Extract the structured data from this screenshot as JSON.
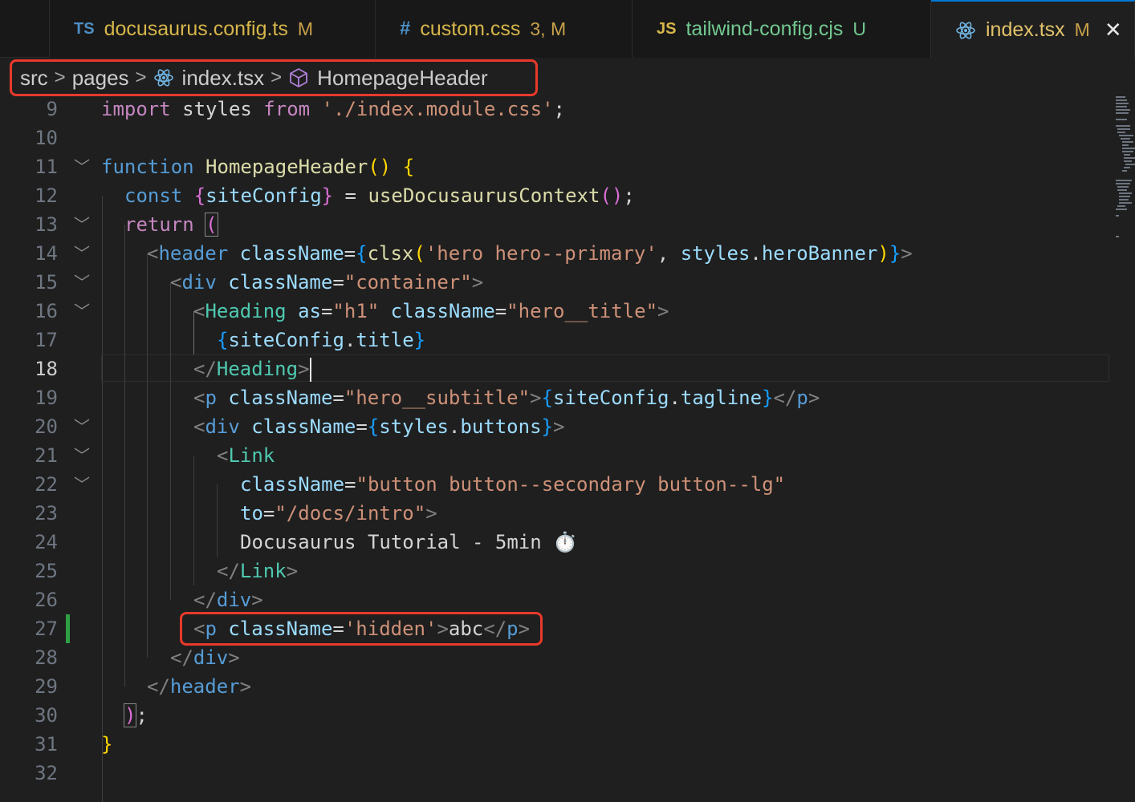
{
  "tabs": [
    {
      "icon": "TS",
      "name": "docusaurus.config.ts",
      "status": "M"
    },
    {
      "icon": "#",
      "name": "custom.css",
      "status": "3, M"
    },
    {
      "icon": "JS",
      "name": "tailwind-config.cjs",
      "status": "U"
    },
    {
      "icon": "react-icon",
      "name": "index.tsx",
      "status": "M"
    }
  ],
  "breadcrumb": {
    "items": [
      "src",
      "pages",
      "index.tsx",
      "HomepageHeader"
    ]
  },
  "editor": {
    "current_line": 18,
    "line_numbers": [
      "9",
      "10",
      "11",
      "12",
      "13",
      "14",
      "15",
      "16",
      "17",
      "18",
      "19",
      "20",
      "21",
      "22",
      "23",
      "24",
      "25",
      "26",
      "27",
      "28",
      "29",
      "30",
      "31",
      "32"
    ],
    "tokens": {
      "l9": [
        "import",
        " styles ",
        "from",
        " ",
        "'./index.module.css'",
        ";"
      ],
      "l11": [
        "function",
        " ",
        "HomepageHeader",
        "()",
        " ",
        "{"
      ],
      "l12": [
        "const",
        " ",
        "{",
        "siteConfig",
        "}",
        " = ",
        "useDocusaurusContext",
        "()",
        ";"
      ],
      "l13": [
        "return",
        " ",
        "("
      ],
      "l14": [
        "<",
        "header",
        " ",
        "className",
        "=",
        "{",
        "clsx",
        "(",
        "'hero hero--primary'",
        ", ",
        "styles",
        ".",
        "heroBanner",
        ")",
        "}",
        ">"
      ],
      "l15": [
        "<",
        "div",
        " ",
        "className",
        "=",
        "\"container\"",
        ">"
      ],
      "l16": [
        "<",
        "Heading",
        " ",
        "as",
        "=",
        "\"h1\"",
        " ",
        "className",
        "=",
        "\"hero__title\"",
        ">"
      ],
      "l17": [
        "{",
        "siteConfig",
        ".",
        "title",
        "}"
      ],
      "l18": [
        "</",
        "Heading",
        ">"
      ],
      "l19": [
        "<",
        "p",
        " ",
        "className",
        "=",
        "\"hero__subtitle\"",
        ">",
        "{",
        "siteConfig",
        ".",
        "tagline",
        "}",
        "</",
        "p",
        ">"
      ],
      "l20": [
        "<",
        "div",
        " ",
        "className",
        "=",
        "{",
        "styles",
        ".",
        "buttons",
        "}",
        ">"
      ],
      "l21": [
        "<",
        "Link"
      ],
      "l22": [
        "className",
        "=",
        "\"button button--secondary button--lg\""
      ],
      "l23": [
        "to",
        "=",
        "\"/docs/intro\"",
        ">"
      ],
      "l24": [
        "Docusaurus Tutorial - 5min ⏱️"
      ],
      "l25": [
        "</",
        "Link",
        ">"
      ],
      "l26": [
        "</",
        "div",
        ">"
      ],
      "l27": [
        "<",
        "p",
        " ",
        "className",
        "=",
        "'hidden'",
        ">",
        "abc",
        "</",
        "p",
        ">"
      ],
      "l28": [
        "</",
        "div",
        ">"
      ],
      "l29": [
        "</",
        "header",
        ">"
      ],
      "l30": [
        ")",
        ";"
      ],
      "l31": [
        "}"
      ]
    }
  },
  "colors": {
    "highlight": "#e8392b",
    "accent": "#0078d4",
    "git_added": "#2ea043"
  }
}
